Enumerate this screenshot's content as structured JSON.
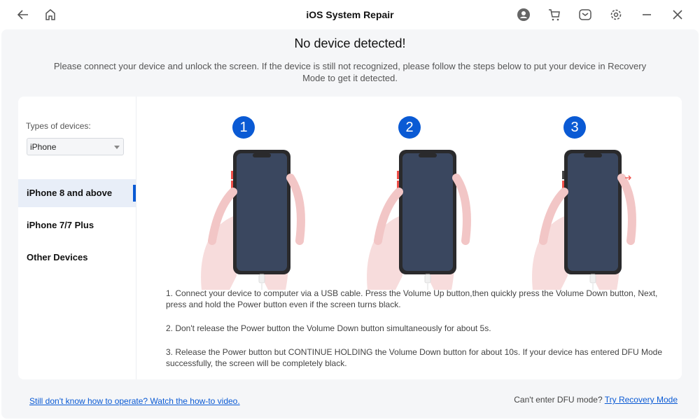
{
  "window": {
    "title": "iOS System Repair"
  },
  "header": {
    "title": "No device detected!",
    "subtitle": "Please connect your device and unlock the screen. If the device is still not recognized, please follow the steps below to put your device in Recovery Mode to get it detected."
  },
  "sidebar": {
    "types_label": "Types of devices:",
    "select_value": "iPhone",
    "items": [
      {
        "label": "iPhone 8 and above",
        "active": true
      },
      {
        "label": "iPhone 7/7 Plus"
      },
      {
        "label": "Other Devices"
      }
    ]
  },
  "steps": [
    "1",
    "2",
    "3"
  ],
  "instructions": [
    "1. Connect your device to computer via a USB cable. Press the Volume Up  button,then quickly press the Volume Down button, Next, press and hold the Power button even if the screen turns black.",
    "2. Don't release the Power button the Volume Down button  simultaneously for about 5s.",
    "3. Release the Power button but CONTINUE HOLDING the Volume Down button for about 10s. If your device has entered DFU Mode successfully, the screen will be completely black."
  ],
  "footer": {
    "video_link": "Still don't know how to operate? Watch the how-to video.",
    "dfu_question": "Can't enter DFU mode?",
    "recovery_link": "Try Recovery Mode"
  },
  "colors": {
    "accent": "#0a5ad4",
    "screen": "#3a475f",
    "highlight": "#f0504a"
  }
}
